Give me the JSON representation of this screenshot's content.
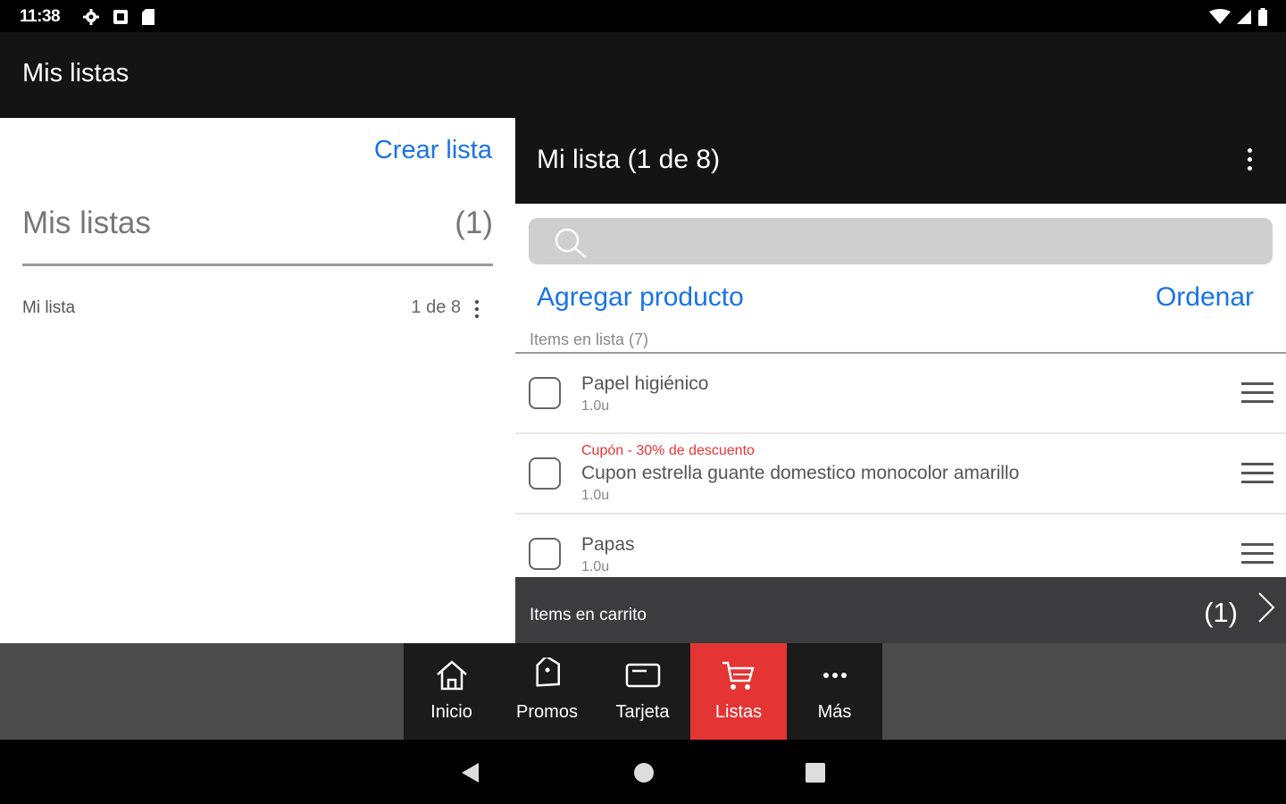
{
  "status_bar": {
    "time": "11:38",
    "left_icons": [
      "settings-icon",
      "notification-icon",
      "sd-card-icon"
    ],
    "right_icons": [
      "wifi-icon",
      "signal-icon",
      "battery-icon"
    ]
  },
  "app_bar": {
    "title": "Mis listas"
  },
  "left_panel": {
    "create_label": "Crear lista",
    "header_title": "Mis listas",
    "header_count": "(1)",
    "lists": [
      {
        "name": "Mi lista",
        "count": "1 de 8"
      }
    ]
  },
  "right_panel": {
    "title": "Mi lista (1 de 8)",
    "search": {
      "placeholder": "",
      "value": ""
    },
    "add_label": "Agregar producto",
    "sort_label": "Ordenar",
    "items_label": "Items en lista (7)",
    "items": [
      {
        "coupon": "",
        "name": "Papel higiénico",
        "qty": "1.0u"
      },
      {
        "coupon": "Cupón - 30% de descuento",
        "name": "Cupon estrella guante domestico monocolor amarillo",
        "qty": "1.0u"
      },
      {
        "coupon": "",
        "name": "Papas",
        "qty": "1.0u"
      }
    ],
    "cart": {
      "label": "Items en carrito",
      "count": "(1)"
    }
  },
  "bottom_nav": [
    {
      "label": "Inicio",
      "icon": "home-icon"
    },
    {
      "label": "Promos",
      "icon": "promo-tag-icon"
    },
    {
      "label": "Tarjeta",
      "icon": "card-icon"
    },
    {
      "label": "Listas",
      "icon": "cart-icon",
      "active": true
    },
    {
      "label": "Más",
      "icon": "more-icon"
    }
  ],
  "colors": {
    "accent": "#1a73e8",
    "active_nav": "#e43434",
    "coupon": "#ee3333"
  }
}
